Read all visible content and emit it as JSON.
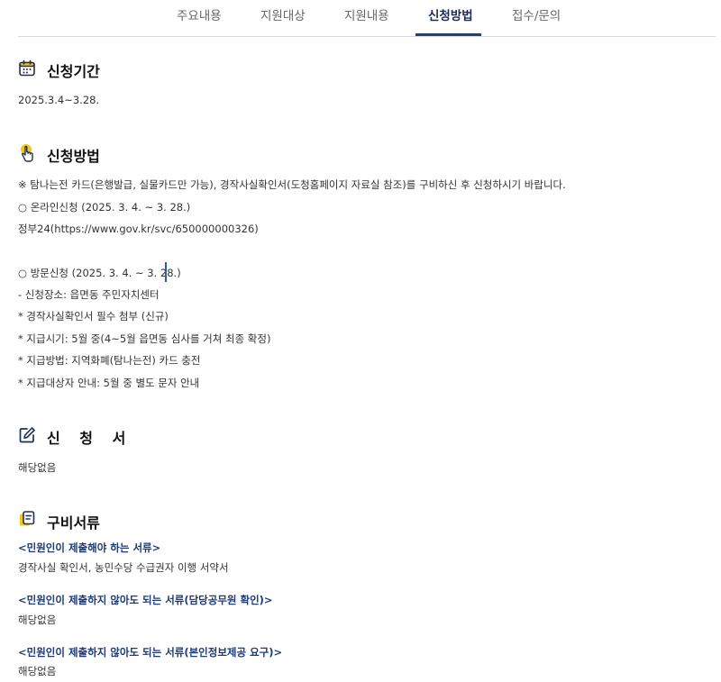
{
  "tabs": [
    {
      "label": "주요내용",
      "active": false
    },
    {
      "label": "지원대상",
      "active": false
    },
    {
      "label": "지원내용",
      "active": false
    },
    {
      "label": "신청방법",
      "active": true
    },
    {
      "label": "접수/문의",
      "active": false
    }
  ],
  "period": {
    "icon": "calendar-icon",
    "title": "신청기간",
    "text": "2025.3.4~3.28."
  },
  "method": {
    "icon": "hand-pointer-icon",
    "title": "신청방법",
    "lines": [
      "※ 탐나는전 카드(은행발급, 실물카드만 가능), 경작사실확인서(도청홈페이지 자료실 참조)를 구비하신 후 신청하시기 바랍니다.",
      "○ 온라인신청 (2025. 3. 4. ~ 3. 28.)",
      "정부24(https://www.gov.kr/svc/650000000326)",
      "○ 방문신청 (2025. 3. 4. ~ 3. 28.)",
      "- 신청장소: 읍면동 주민자치센터",
      "* 경작사실확인서 필수 첨부 (신규)",
      "* 지급시기: 5월 중(4~5월 읍면동 심사를 거쳐 최종 확정)",
      "* 지급방법: 지역화폐(탐나는전) 카드 충전",
      "* 지급대상자 안내: 5월 중 별도 문자 안내"
    ]
  },
  "form": {
    "icon": "edit-icon",
    "title": "신 청 서",
    "text": "해당없음"
  },
  "documents": {
    "icon": "documents-icon",
    "title": "구비서류",
    "groups": [
      {
        "heading": "<민원인이 제출해야 하는 서류>",
        "text": "경작사실 확인서, 농민수당 수급권자 이행 서약서"
      },
      {
        "heading": "<민원인이 제출하지 않아도 되는 서류(담당공무원 확인)>",
        "text": "해당없음"
      },
      {
        "heading": "<민원인이 제출하지 않아도 되는 서류(본인정보제공 요구)>",
        "text": "해당없음"
      }
    ]
  },
  "colors": {
    "accent": "#1c3f86",
    "subhead": "#1d3a7a",
    "icon_yellow": "#f5c518"
  }
}
